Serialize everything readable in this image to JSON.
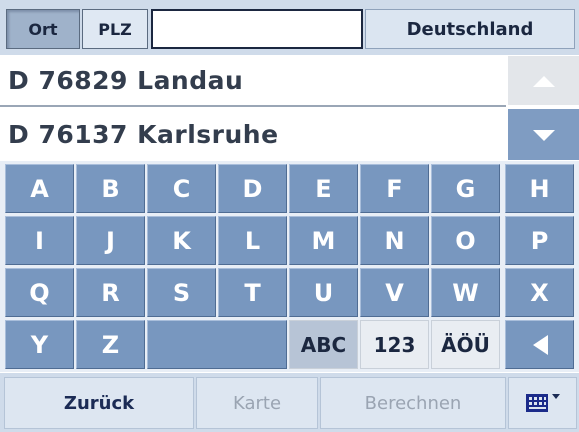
{
  "header": {
    "tab_ort": "Ort",
    "tab_plz": "PLZ",
    "search_value": "",
    "country": "Deutschland"
  },
  "results": [
    "D 76829 Landau",
    "D 76137 Karlsruhe"
  ],
  "scroll": {
    "up_icon": "arrow-up-icon",
    "down_icon": "arrow-down-icon"
  },
  "keyboard": {
    "rows": [
      [
        "A",
        "B",
        "C",
        "D",
        "E",
        "F",
        "G",
        "H"
      ],
      [
        "I",
        "J",
        "K",
        "L",
        "M",
        "N",
        "O",
        "P"
      ],
      [
        "Q",
        "R",
        "S",
        "T",
        "U",
        "V",
        "W",
        "X"
      ]
    ],
    "last_row": {
      "y": "Y",
      "z": "Z",
      "abc": "ABC",
      "num": "123",
      "umlaut": "ÄÖÜ",
      "backspace_icon": "backspace-arrow-icon"
    }
  },
  "footer": {
    "back": "Zurück",
    "map": "Karte",
    "calculate": "Berechnen",
    "keyboard_icon": "keyboard-grid-icon"
  },
  "colors": {
    "key": "#7897bf",
    "bar": "#cfdbea",
    "text": "#1b2740"
  }
}
